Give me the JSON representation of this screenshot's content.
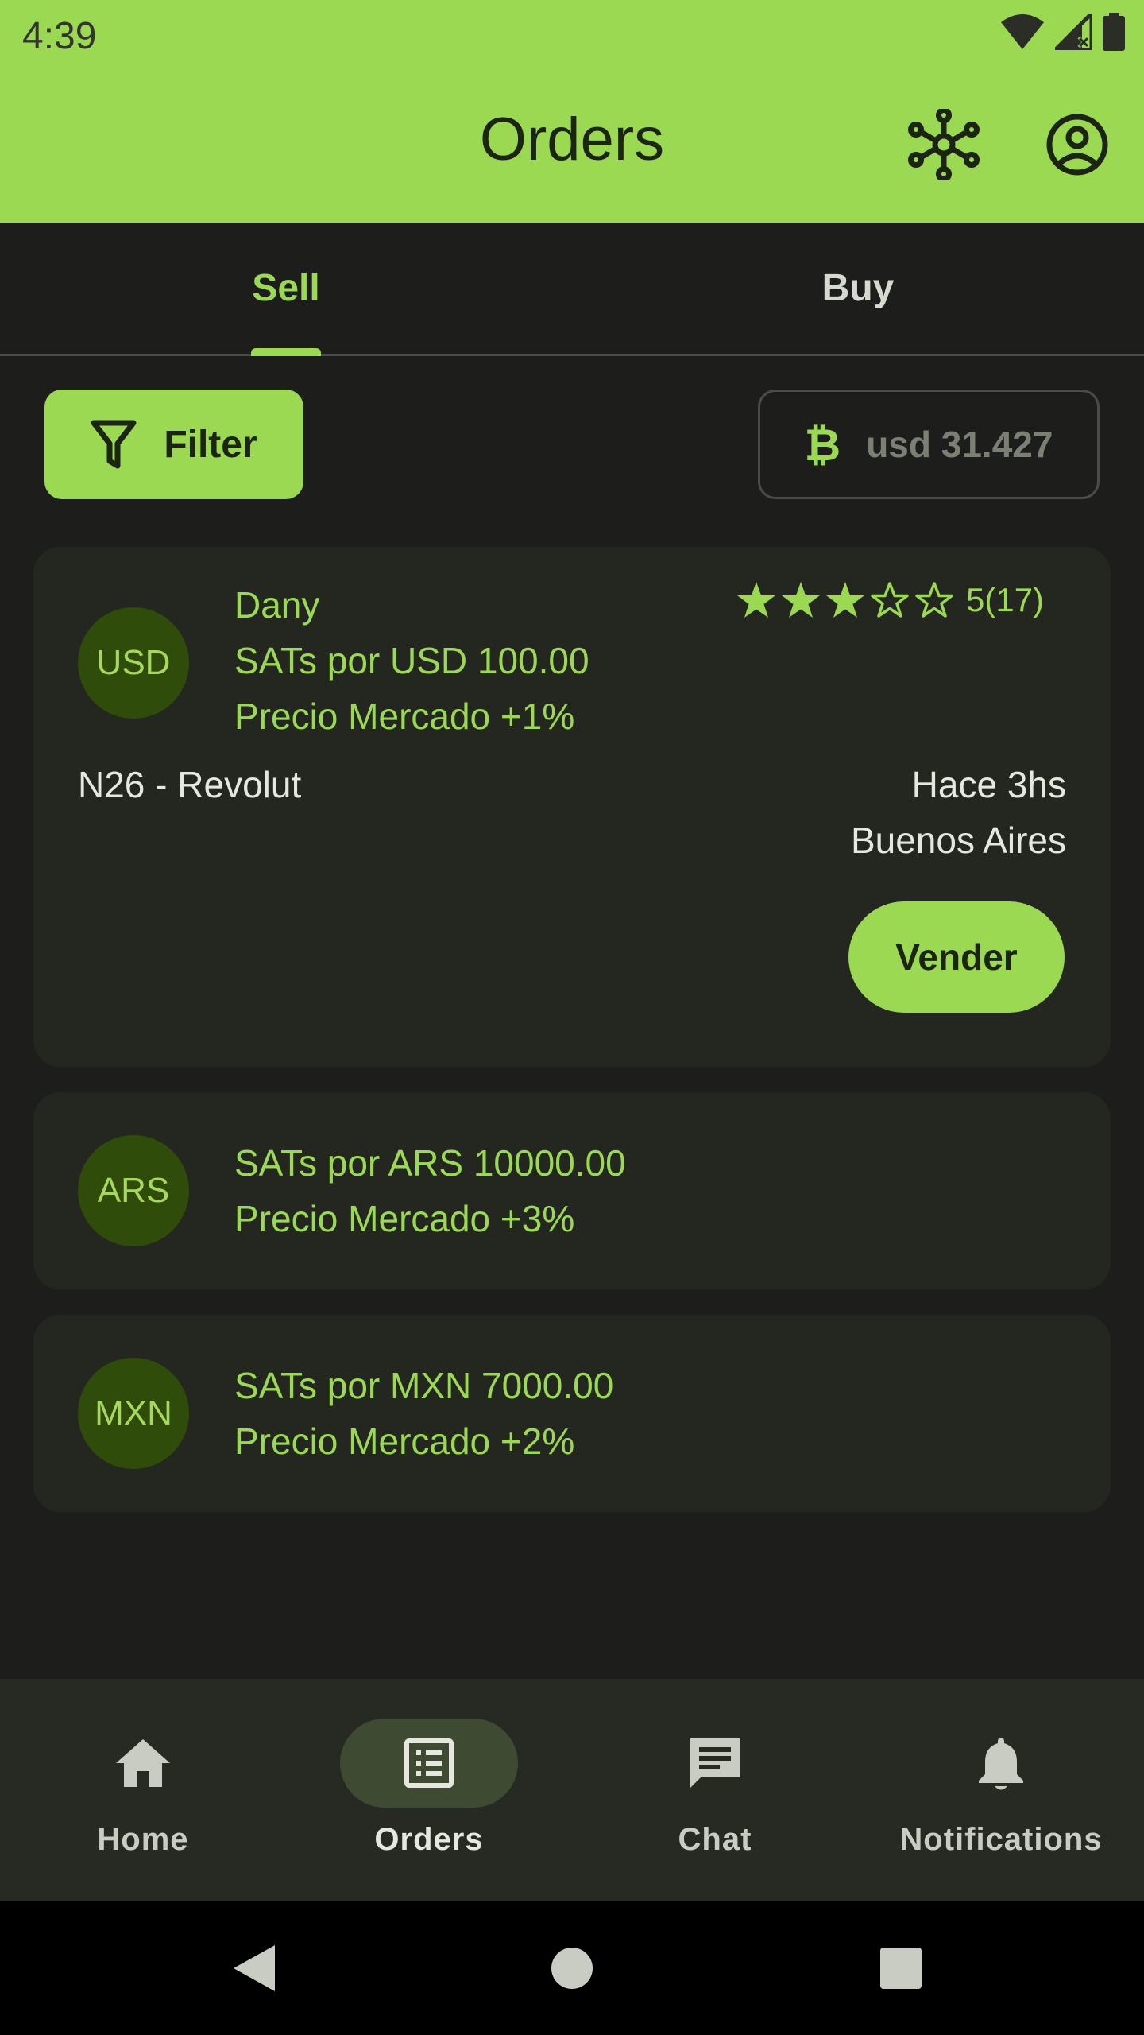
{
  "status_bar": {
    "time": "4:39"
  },
  "app_bar": {
    "title": "Orders",
    "icons": [
      "hub-network-icon",
      "account-circle-icon"
    ]
  },
  "tabs": [
    {
      "label": "Sell",
      "selected": true
    },
    {
      "label": "Buy",
      "selected": false
    }
  ],
  "filter": {
    "label": "Filter",
    "icon": "filter-funnel-icon"
  },
  "btc_rate": {
    "symbol": "₿",
    "value": "usd 31.427"
  },
  "orders": [
    {
      "currency": "USD",
      "user": "Dany",
      "amount_line": "SATs por USD 100.00",
      "premium_line": "Precio Mercado +1%",
      "rating_stars": 3,
      "rating_max": 5,
      "rating_text": "5(17)",
      "payment_methods": "N26 - Revolut",
      "time_ago": "Hace 3hs",
      "location": "Buenos Aires",
      "action_label": "Vender"
    },
    {
      "currency": "ARS",
      "amount_line": "SATs por ARS 10000.00",
      "premium_line": "Precio Mercado +3%"
    },
    {
      "currency": "MXN",
      "amount_line": "SATs por MXN 7000.00",
      "premium_line": "Precio Mercado +2%"
    }
  ],
  "bottom_nav": [
    {
      "label": "Home",
      "icon": "home-icon",
      "active": false
    },
    {
      "label": "Orders",
      "icon": "list-alt-icon",
      "active": true
    },
    {
      "label": "Chat",
      "icon": "chat-icon",
      "active": false
    },
    {
      "label": "Notifications",
      "icon": "bell-icon",
      "active": false
    }
  ],
  "colors": {
    "accent": "#9bd952",
    "background": "#1d1e1b",
    "card": "#242720",
    "avatar": "#2f4c0a"
  }
}
